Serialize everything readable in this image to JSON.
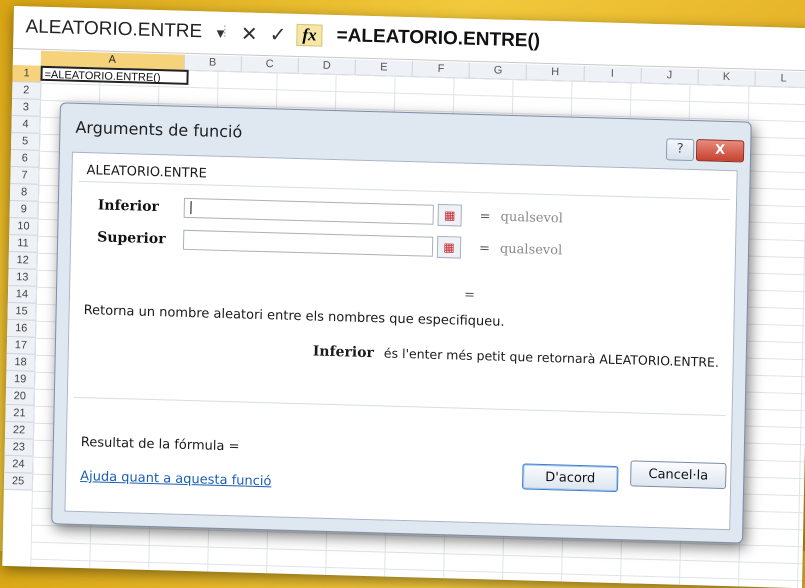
{
  "formula_bar": {
    "name_box": "ALEATORIO.ENTRE",
    "cancel_icon": "✕",
    "enter_icon": "✓",
    "fx_label": "fx",
    "formula": "=ALEATORIO.ENTRE()"
  },
  "sheet": {
    "columns": [
      "A",
      "B",
      "C",
      "D",
      "E",
      "F",
      "G",
      "H",
      "I",
      "J",
      "K",
      "L"
    ],
    "rows": [
      "1",
      "2",
      "3",
      "4",
      "5",
      "6",
      "7",
      "8",
      "9",
      "10",
      "11",
      "12",
      "13",
      "14",
      "15",
      "16",
      "17",
      "18",
      "19",
      "20",
      "21",
      "22",
      "23",
      "24",
      "25"
    ],
    "cell_a1": "=ALEATORIO.ENTRE()"
  },
  "dialog": {
    "title": "Arguments de funció",
    "help_button": "?",
    "close_button": "X",
    "function_name": "ALEATORIO.ENTRE",
    "args": [
      {
        "label": "Inferior",
        "value": "|",
        "equals": "=",
        "result": "qualsevol"
      },
      {
        "label": "Superior",
        "value": "",
        "equals": "=",
        "result": "qualsevol"
      }
    ],
    "result_equals": "=",
    "description": "Retorna un nombre aleatori entre els nombres que especifiqueu.",
    "arg_name": "Inferior",
    "arg_description": "és l'enter més petit que retornarà ALEATORIO.ENTRE.",
    "formula_result": "Resultat de la fórmula =",
    "help_link": "Ajuda quant a aquesta funció",
    "ok_button": "D'acord",
    "cancel_button": "Cancel·la"
  }
}
